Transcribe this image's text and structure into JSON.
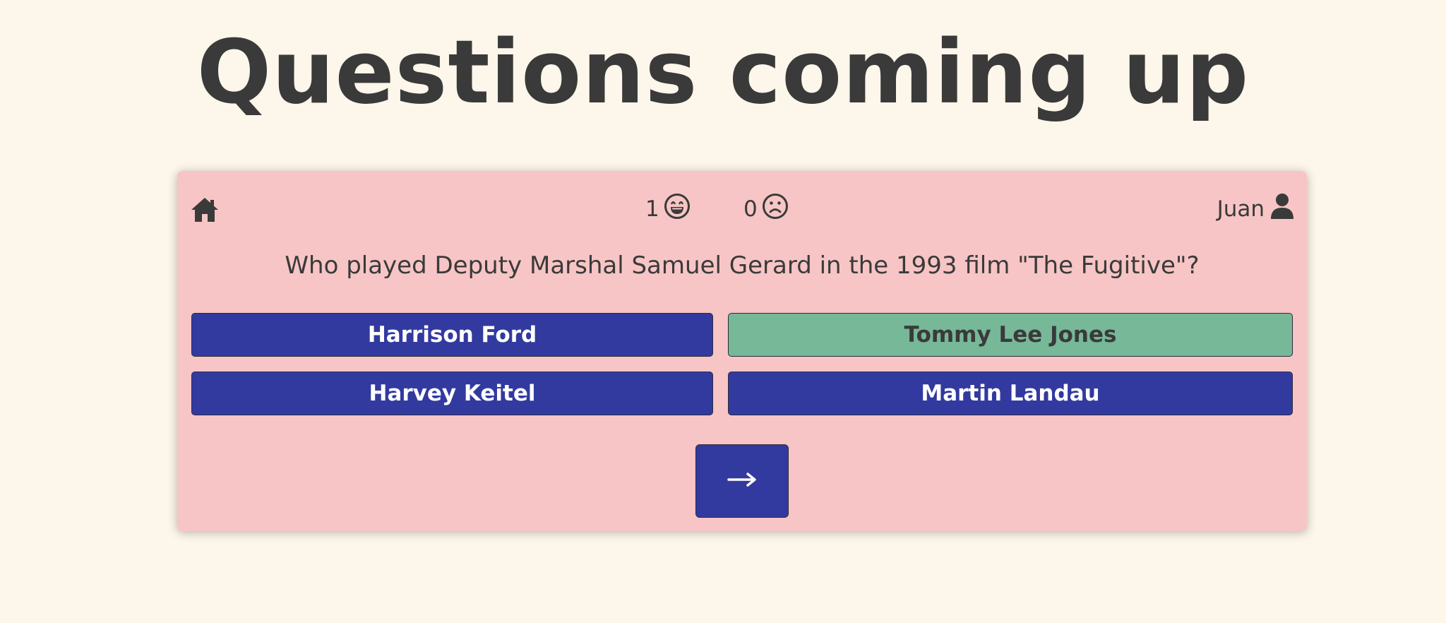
{
  "page": {
    "title": "Questions coming up"
  },
  "header": {
    "home_icon": "home-icon",
    "correct_count": "1",
    "correct_icon": "grinning-face-icon",
    "wrong_count": "0",
    "wrong_icon": "frowning-face-icon",
    "username": "Juan",
    "user_icon": "user-icon"
  },
  "question": {
    "text": "Who played Deputy Marshal Samuel Gerard in the 1993 film \"The Fugitive\"?"
  },
  "answers": [
    {
      "label": "Harrison Ford",
      "state": "default"
    },
    {
      "label": "Tommy Lee Jones",
      "state": "correct"
    },
    {
      "label": "Harvey Keitel",
      "state": "default"
    },
    {
      "label": "Martin Landau",
      "state": "default"
    }
  ],
  "next_button": {
    "icon": "arrow-right-icon"
  },
  "colors": {
    "background": "#fdf6ea",
    "card": "#f7c5c5",
    "answer_default": "#323aa0",
    "answer_correct": "#76b897",
    "text": "#3a3a3a"
  }
}
